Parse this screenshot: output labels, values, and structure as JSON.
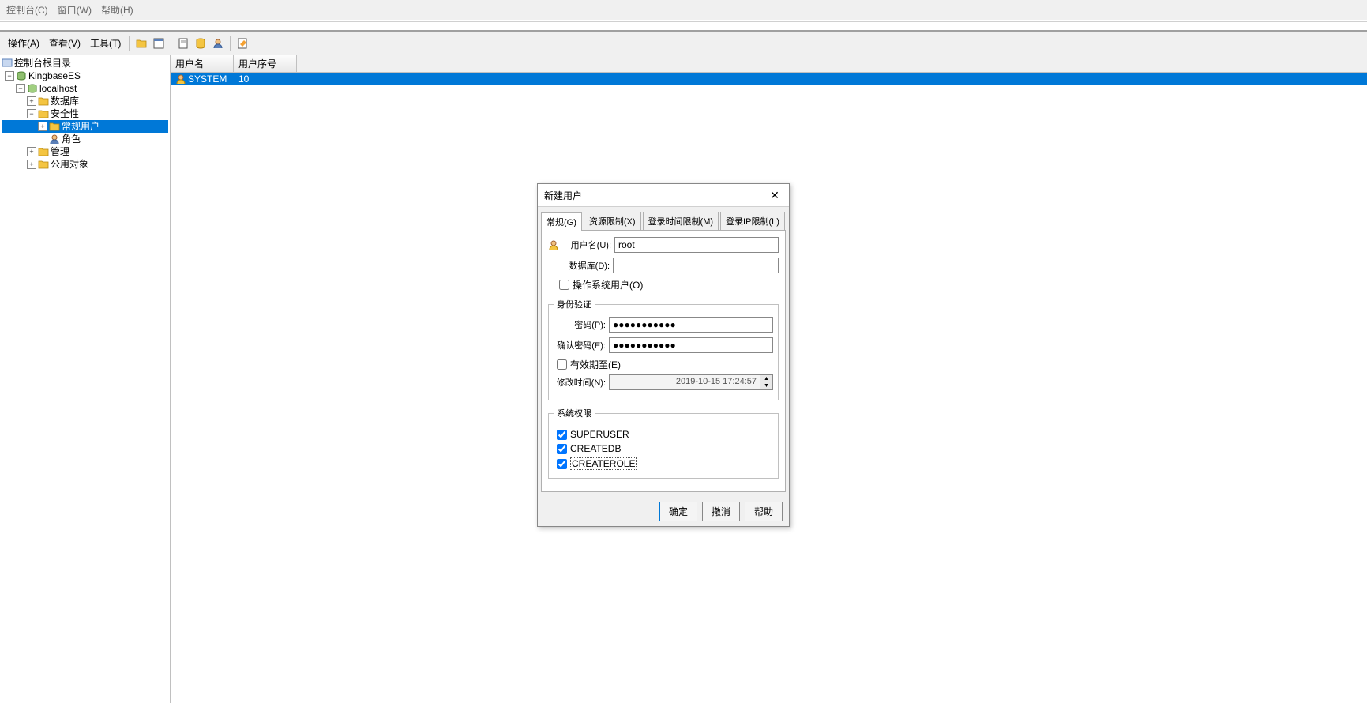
{
  "menubar": {
    "console": "控制台(C)",
    "window": "窗口(W)",
    "help": "帮助(H)"
  },
  "toolbar": {
    "action": "操作(A)",
    "view": "查看(V)",
    "tools": "工具(T)"
  },
  "tree": {
    "root": "控制台根目录",
    "kingbase": "KingbaseES",
    "localhost": "localhost",
    "database": "数据库",
    "security": "安全性",
    "regular_user": "常规用户",
    "role": "角色",
    "manage": "管理",
    "public_obj": "公用对象"
  },
  "grid": {
    "col_user": "用户名",
    "col_seq": "用户序号",
    "row_user": "SYSTEM",
    "row_seq": "10"
  },
  "dialog": {
    "title": "新建用户",
    "tabs": {
      "general": "常规(G)",
      "resource": "资源限制(X)",
      "login_time": "登录时间限制(M)",
      "login_ip": "登录IP限制(L)"
    },
    "username_label": "用户名(U):",
    "username_value": "root",
    "database_label": "数据库(D):",
    "database_value": "",
    "os_user": "操作系统用户(O)",
    "auth_legend": "身份验证",
    "password_label": "密码(P):",
    "password_value": "●●●●●●●●●●●",
    "confirm_label": "确认密码(E):",
    "confirm_value": "●●●●●●●●●●●",
    "expire_label": "有效期至(E)",
    "modtime_label": "修改时间(N):",
    "modtime_value": "2019-10-15 17:24:57",
    "perm_legend": "系统权限",
    "perm_superuser": "SUPERUSER",
    "perm_createdb": "CREATEDB",
    "perm_createrole": "CREATEROLE",
    "ok": "确定",
    "cancel": "撤消",
    "help": "帮助"
  }
}
